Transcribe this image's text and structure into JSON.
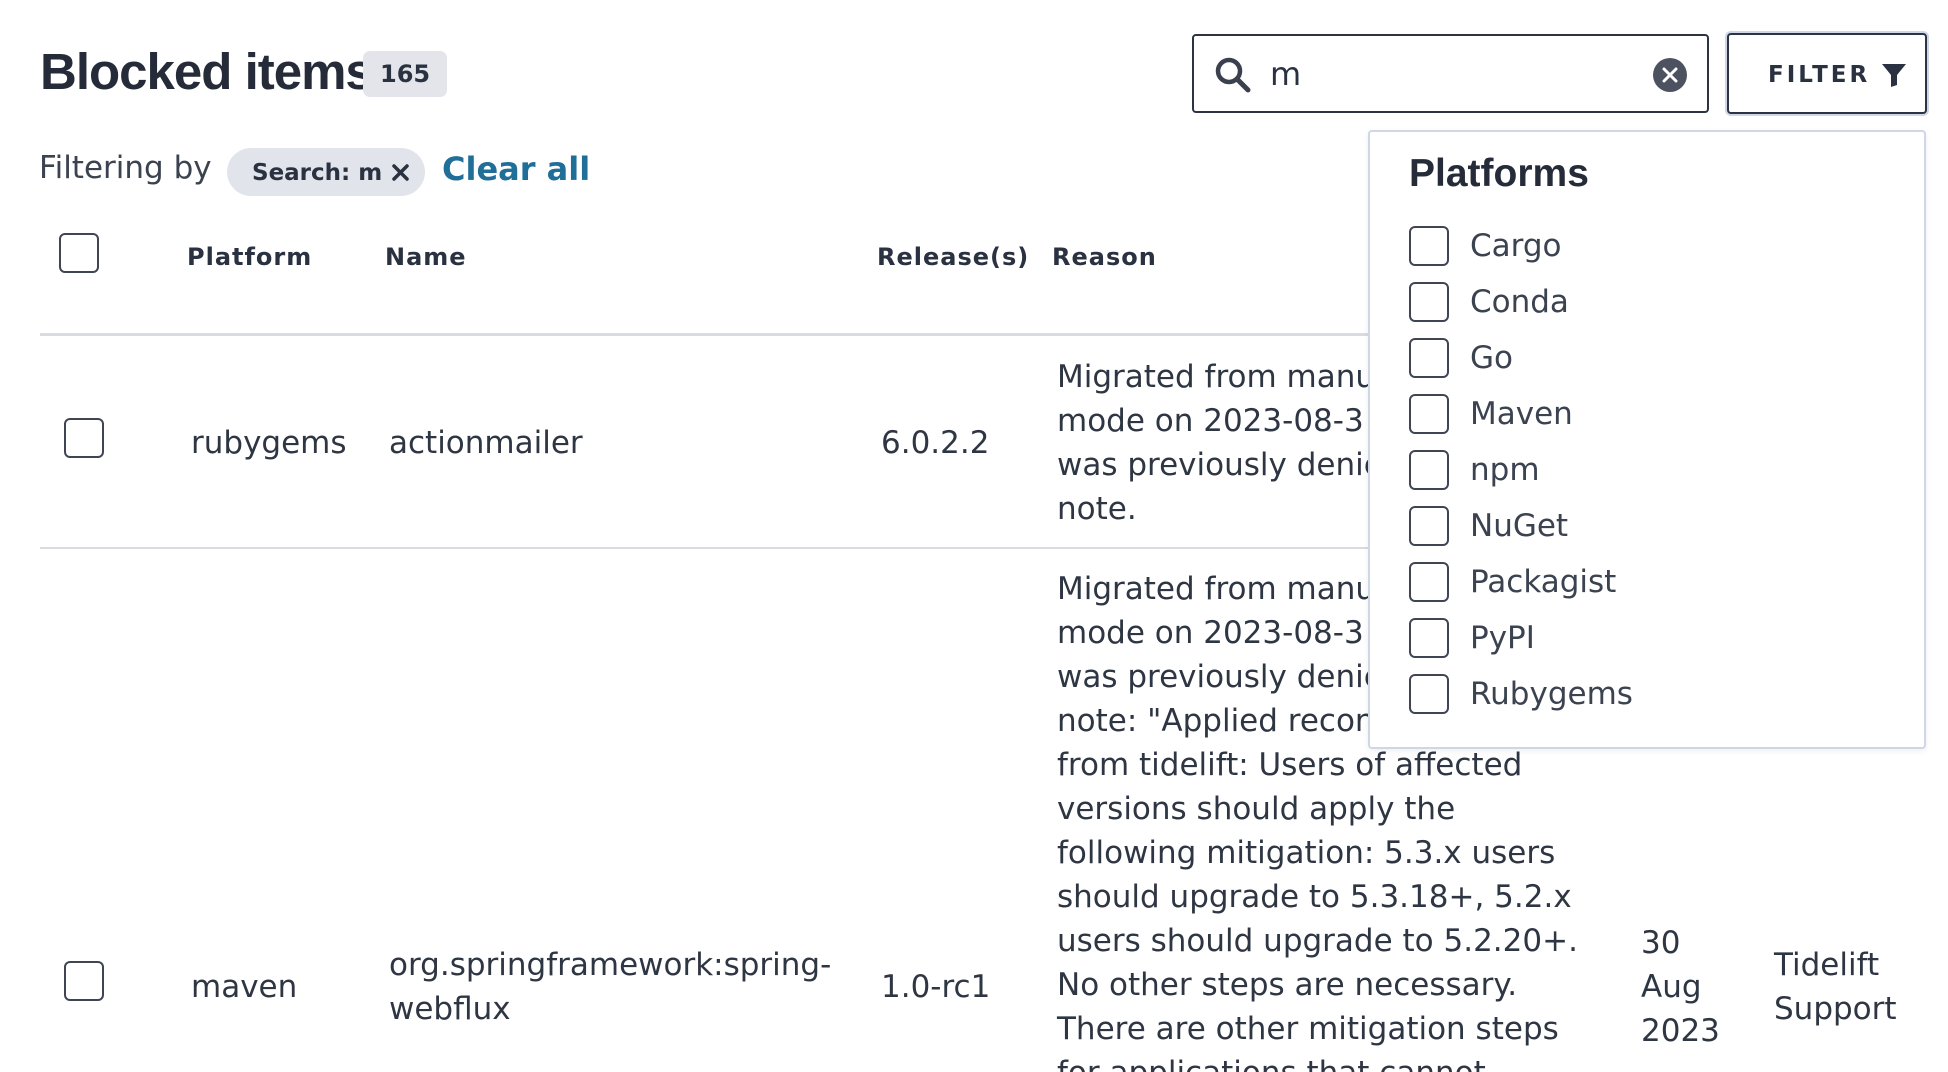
{
  "header": {
    "title": "Blocked items",
    "count": "165"
  },
  "search": {
    "value": "m",
    "icon": "search-icon",
    "clear_icon": "clear-circle-icon"
  },
  "filter_button": {
    "label": "FILTER",
    "icon": "funnel-icon"
  },
  "filtering": {
    "label": "Filtering by",
    "chips": [
      {
        "label": "Search: m",
        "remove_icon": "close-icon"
      }
    ],
    "clear_all": "Clear all"
  },
  "table": {
    "columns": [
      "Platform",
      "Name",
      "Release(s)",
      "Reason"
    ],
    "rows": [
      {
        "platform": "rubygems",
        "name": "actionmailer",
        "release": "6.0.2.2",
        "reason_lines": [
          "Migrated from manu",
          "mode on 2023-08-3",
          "was previously denie",
          "note."
        ],
        "date_lines": [],
        "source_lines": []
      },
      {
        "platform": "maven",
        "name_lines": [
          "org.springframework:spring-",
          "webflux"
        ],
        "release": "1.0-rc1",
        "reason_lines": [
          "Migrated from manu",
          "mode on 2023-08-3",
          "was previously denie",
          "note: \"Applied recon",
          "from tidelift: Users of affected",
          "versions should apply the",
          "following mitigation: 5.3.x users",
          "should upgrade to 5.3.18+, 5.2.x",
          "users should upgrade to 5.2.20+.",
          "No other steps are necessary.",
          "There are other mitigation steps",
          "for applications that cannot"
        ],
        "date_lines": [
          "30",
          "Aug",
          "2023"
        ],
        "source_lines": [
          "Tidelift",
          "Support"
        ]
      }
    ]
  },
  "platforms_dropdown": {
    "title": "Platforms",
    "options": [
      "Cargo",
      "Conda",
      "Go",
      "Maven",
      "npm",
      "NuGet",
      "Packagist",
      "PyPI",
      "Rubygems"
    ]
  },
  "colors": {
    "text": "#2a3140",
    "link": "#1f6f99",
    "badge_bg": "#e3e5ea",
    "chip_bg": "#e1e4ea",
    "border": "#2c3342",
    "dropdown_border": "#cfd6e6"
  }
}
